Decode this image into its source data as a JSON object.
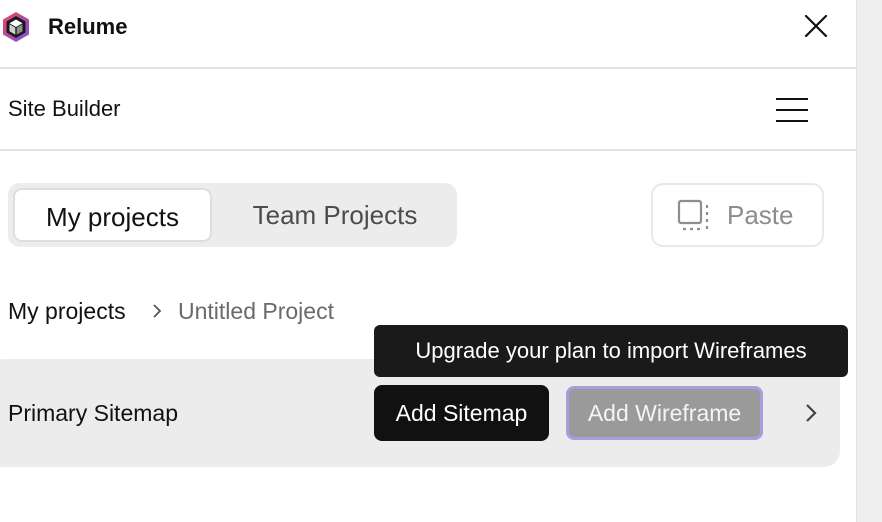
{
  "app": {
    "title": "Relume",
    "close_icon": "close-icon",
    "brand_colors": [
      "#e83a5b",
      "#7b4fe0",
      "#1a1a1a"
    ]
  },
  "section": {
    "title": "Site Builder",
    "menu_icon": "hamburger-menu-icon"
  },
  "tabs": [
    {
      "label": "My projects",
      "active": true
    },
    {
      "label": "Team Projects",
      "active": false
    }
  ],
  "paste": {
    "label": "Paste",
    "icon": "paste-icon"
  },
  "breadcrumb": {
    "root": "My projects",
    "current": "Untitled Project"
  },
  "sitemap": {
    "name": "Primary Sitemap",
    "add_sitemap_label": "Add Sitemap",
    "add_wireframe_label": "Add Wireframe",
    "tooltip": "Upgrade your plan to import Wireframes"
  }
}
